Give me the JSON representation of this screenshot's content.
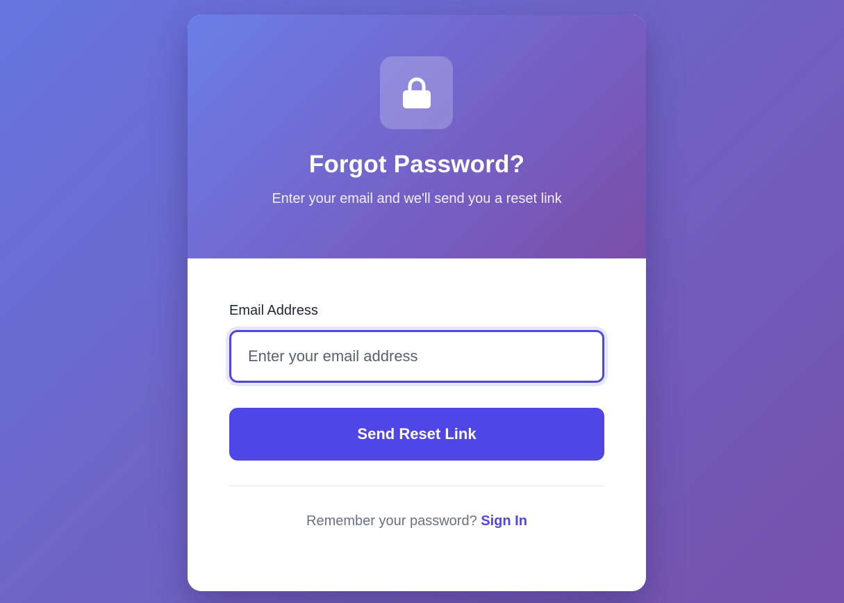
{
  "header": {
    "icon": "lock-icon",
    "title": "Forgot Password?",
    "subtitle": "Enter your email and we'll send you a reset link"
  },
  "form": {
    "email_label": "Email Address",
    "email_placeholder": "Enter your email address",
    "email_value": "",
    "submit_label": "Send Reset Link"
  },
  "footer": {
    "prompt": "Remember your password?",
    "link_label": "Sign In"
  },
  "colors": {
    "accent": "#4f46e5",
    "header_gradient_start": "#6a7fe8",
    "header_gradient_end": "#7b4ea8",
    "background_start": "#6675e0",
    "background_end": "#7651ad"
  }
}
